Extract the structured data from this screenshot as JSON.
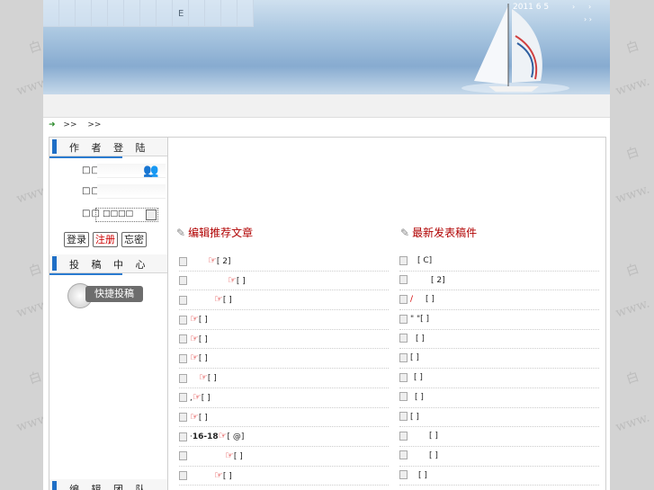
{
  "banner": {
    "letter": "E",
    "date": "2011 6 5",
    "nav_arrows": [
      "›",
      "›",
      "› ›"
    ]
  },
  "breadcrumb": {
    "arrow": "➜",
    "sep1": ">>",
    "sep2": ">>"
  },
  "login": {
    "title": "作 者 登 陆",
    "user_label": "□□",
    "pass_label": "□□",
    "type_label": "□□",
    "type_value": "□□□□",
    "buttons": {
      "login": "登录",
      "register": "注册",
      "forgot": "忘密"
    }
  },
  "submit": {
    "title": "投 稿 中 心",
    "quick_label": "快捷投稿"
  },
  "team": {
    "title": "编 辑 团 队"
  },
  "columns": {
    "left_title": "编辑推荐文章",
    "right_title": "最新发表稿件"
  },
  "left_items": [
    {
      "prefix": "",
      "suffix": "[ 2]"
    },
    {
      "prefix": "",
      "suffix": "[ ]"
    },
    {
      "prefix": "",
      "suffix": "[ ]"
    },
    {
      "prefix": "",
      "suffix": "[ ]"
    },
    {
      "prefix": "",
      "suffix": "[ ]"
    },
    {
      "prefix": "",
      "suffix": "[ ]"
    },
    {
      "prefix": "",
      "suffix": "[ ]"
    },
    {
      "prefix": ",",
      "suffix": "[ ]"
    },
    {
      "prefix": "",
      "suffix": "[ ]"
    },
    {
      "prefix": "·",
      "bold": "16-18",
      "suffix": "[ @]"
    },
    {
      "prefix": "",
      "suffix": "[ ]"
    },
    {
      "prefix": "",
      "suffix": "[ ]"
    }
  ],
  "right_items": [
    {
      "text": "[ C]"
    },
    {
      "text": "[ 2]"
    },
    {
      "red": "/",
      "text": "[ ]"
    },
    {
      "text": "\"  \"[ ]"
    },
    {
      "text": "[ ]"
    },
    {
      "text": "[ ]"
    },
    {
      "text": "[ ]"
    },
    {
      "text": "[ ]"
    },
    {
      "text": "[ ]"
    },
    {
      "text": "[ ]"
    },
    {
      "text": "[ ]"
    },
    {
      "text": "[ ]"
    }
  ]
}
